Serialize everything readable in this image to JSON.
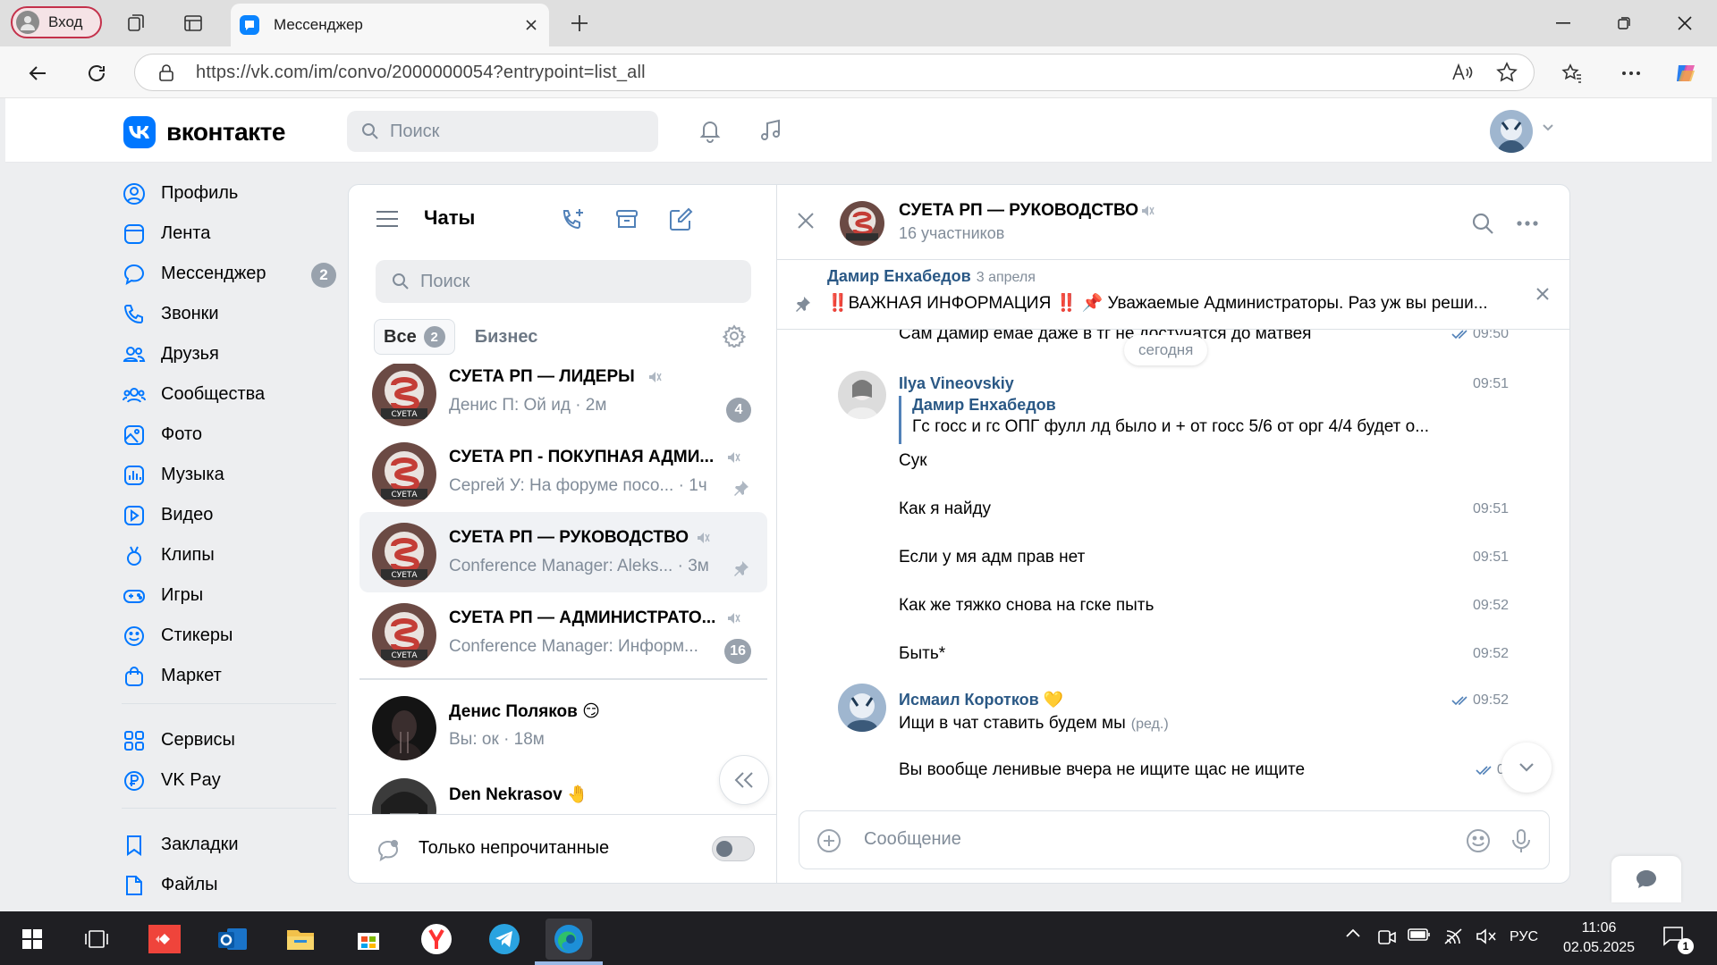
{
  "browser": {
    "login_label": "Вход",
    "tab_title": "Мессенджер",
    "url": "https://vk.com/im/convo/2000000054?entrypoint=list_all"
  },
  "vk": {
    "logo_text": "вконтакте",
    "search_placeholder": "Поиск",
    "menu": [
      {
        "label": "Профиль",
        "icon": "profile-icon"
      },
      {
        "label": "Лента",
        "icon": "feed-icon"
      },
      {
        "label": "Мессенджер",
        "icon": "messenger-icon",
        "badge": "2"
      },
      {
        "label": "Звонки",
        "icon": "calls-icon"
      },
      {
        "label": "Друзья",
        "icon": "friends-icon"
      },
      {
        "label": "Сообщества",
        "icon": "communities-icon"
      },
      {
        "label": "Фото",
        "icon": "photo-icon"
      },
      {
        "label": "Музыка",
        "icon": "music-icon"
      },
      {
        "label": "Видео",
        "icon": "video-icon"
      },
      {
        "label": "Клипы",
        "icon": "clips-icon"
      },
      {
        "label": "Игры",
        "icon": "games-icon"
      },
      {
        "label": "Стикеры",
        "icon": "stickers-icon"
      },
      {
        "label": "Маркет",
        "icon": "market-icon"
      }
    ],
    "menu2": [
      {
        "label": "Сервисы",
        "icon": "services-icon"
      },
      {
        "label": "VK Pay",
        "icon": "vkpay-icon"
      }
    ],
    "menu3": [
      {
        "label": "Закладки",
        "icon": "bookmarks-icon"
      },
      {
        "label": "Файлы",
        "icon": "files-icon"
      }
    ]
  },
  "chats": {
    "title": "Чаты",
    "search_placeholder": "Поиск",
    "tab_all": "Все",
    "tab_all_count": "2",
    "tab_business": "Бизнес",
    "items": [
      {
        "name": "СУЕТА РП — ЛИДЕРЫ",
        "preview": "Денис П: Ой ид",
        "time": "· 2м",
        "count": "4",
        "muted": true
      },
      {
        "name": "СУЕТА РП - ПОКУПНАЯ АДМИ...",
        "preview": "Сергей У: На форуме посо...",
        "time": "· 1ч",
        "pinned": true,
        "muted": true
      },
      {
        "name": "СУЕТА РП — РУКОВОДСТВО",
        "preview": "Conference Manager: Aleks...",
        "time": "· 3м",
        "pinned": true,
        "muted": true,
        "selected": true
      },
      {
        "name": "СУЕТА РП — АДМИНИСТРАТО...",
        "preview": "Conference Manager: Информ...",
        "count": "16",
        "muted": true
      },
      {
        "name": "Денис Поляков 😏",
        "preview": "Вы: ок",
        "time": "· 18м"
      },
      {
        "name": "Den Nekrasov 🤚",
        "preview": ""
      }
    ],
    "unread_only_label": "Только непрочитанные"
  },
  "convo": {
    "title": "СУЕТА РП — РУКОВОДСТВО",
    "subtitle": "16 участников",
    "pinned_author": "Дамир Енхабедов",
    "pinned_date": "3 апреля",
    "pinned_text": "‼️ВАЖНАЯ ИНФОРМАЦИЯ ‼️ 📌 Уважаемые Администраторы. Раз уж вы реши...",
    "day_label": "сегодня",
    "messages": {
      "top_cut": "Сам Дамир емае даже в тг не достучатся до матвея",
      "top_cut_time": "09:50",
      "author1": "Ilya Vineovskiy",
      "author1_time": "09:51",
      "reply_author": "Дамир Енхабедов",
      "reply_text": "Гс госс и гс ОПГ фулл лд было и + от госс 5/6 от орг 4/4 будет о...",
      "m1": "Сук",
      "m2": "Как я найду",
      "m2_time": "09:51",
      "m3": "Если у мя адм прав  нет",
      "m3_time": "09:51",
      "m4": "Как же тяжко снова на гске пыть",
      "m4_time": "09:52",
      "m5": "Быть*",
      "m5_time": "09:52",
      "author2": "Исмаил Коротков 💛",
      "author2_time": "09:52",
      "m6": "Ищи в чат ставить будем мы",
      "m6_edited": "(ред.)",
      "m7": "Вы вообще ленивые вчера не ищите щас не ищите",
      "m7_time": "09:5"
    },
    "composer_placeholder": "Сообщение"
  },
  "taskbar": {
    "lang": "РУС",
    "time": "11:06",
    "date": "02.05.2025",
    "notif_count": "1"
  },
  "colors": {
    "vk_blue": "#0077ff",
    "link_blue": "#2a5885",
    "badge_gray": "#99a2ad",
    "page_bg": "#edeef0"
  }
}
